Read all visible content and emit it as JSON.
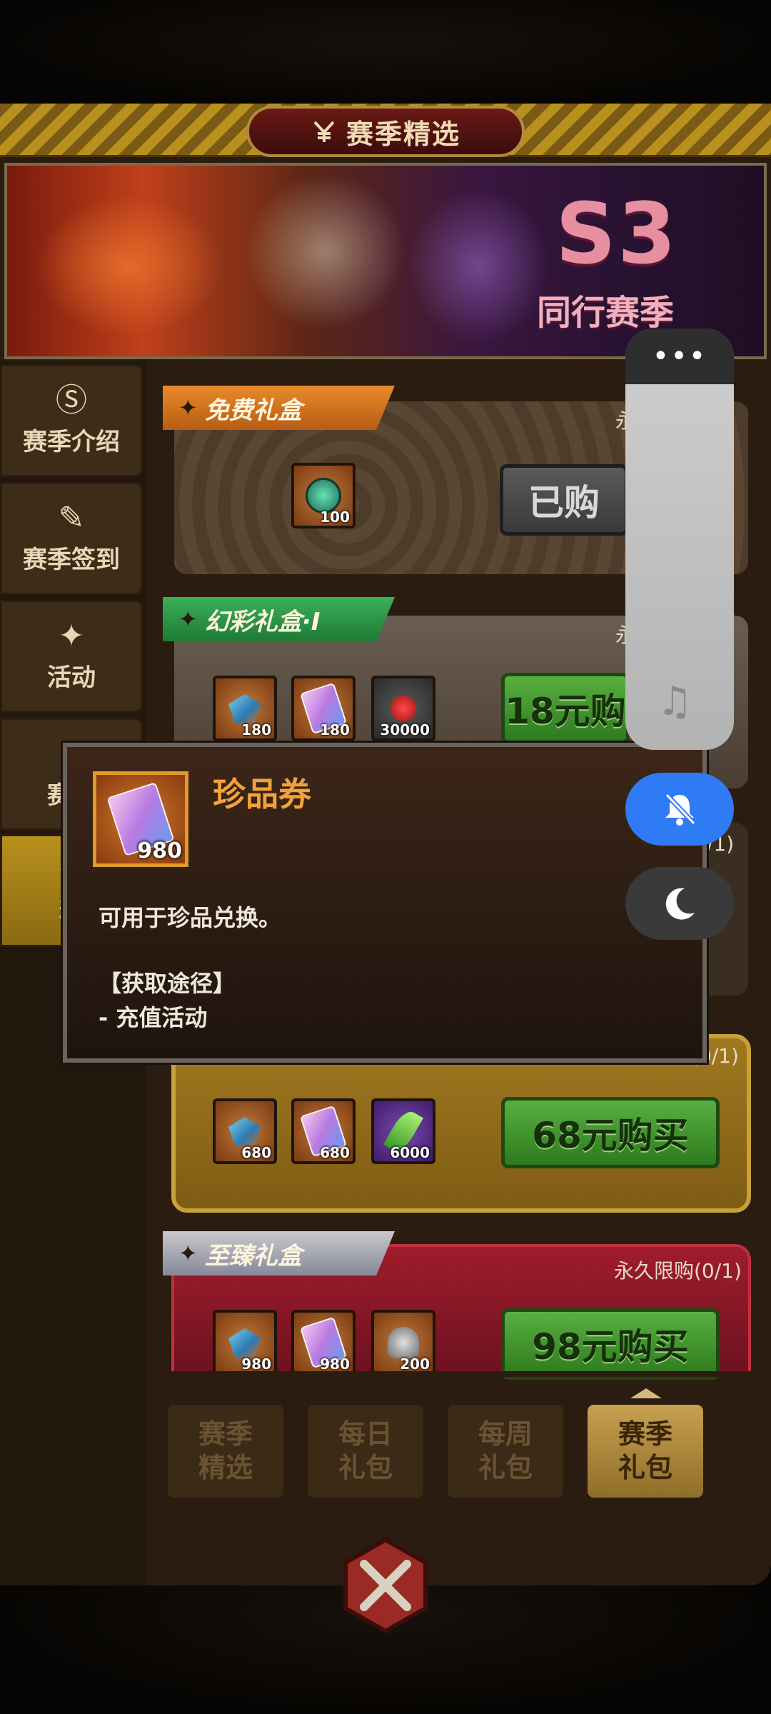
{
  "header": {
    "title": "赛季精选",
    "title_icon": "yen-scissor-icon"
  },
  "banner": {
    "season_code": "S3",
    "season_name": "同行赛季"
  },
  "sidebar": {
    "items": [
      {
        "label": "赛季介绍",
        "icon": "s-badge-icon",
        "active": false
      },
      {
        "label": "赛季签到",
        "icon": "pen-icon",
        "active": false
      },
      {
        "label": "活动",
        "icon": "gift-icon",
        "active": false
      },
      {
        "label": "赛季",
        "icon": "star-icon",
        "active": false
      },
      {
        "label": "精",
        "icon": "crest-icon",
        "active": true
      }
    ]
  },
  "gifts": [
    {
      "name": "免费礼盒",
      "limit": "永",
      "items": [
        {
          "icon": "coin-icon",
          "qty": "100"
        }
      ],
      "button": "已购"
    },
    {
      "name": "幻彩礼盒·I",
      "limit": "永",
      "items": [
        {
          "icon": "gem-icon",
          "qty": "180"
        },
        {
          "icon": "ticket-icon",
          "qty": "180"
        },
        {
          "icon": "flower-icon",
          "qty": "30000"
        }
      ],
      "button": "18元购"
    },
    {
      "name": "",
      "limit": "/1)",
      "items": [],
      "button": ""
    },
    {
      "name": "",
      "limit": "(0/1)",
      "items": [
        {
          "icon": "gem-icon",
          "qty": "680"
        },
        {
          "icon": "ticket-icon",
          "qty": "680"
        },
        {
          "icon": "leaf-icon",
          "qty": "6000"
        }
      ],
      "button": "68元购买"
    },
    {
      "name": "至臻礼盒",
      "limit": "永久限购(0/1)",
      "items": [
        {
          "icon": "gem-icon",
          "qty": "980"
        },
        {
          "icon": "ticket-icon",
          "qty": "980"
        },
        {
          "icon": "bell-icon",
          "qty": "200"
        }
      ],
      "button": "98元购买"
    }
  ],
  "bottom_tabs": [
    {
      "line1": "赛季",
      "line2": "精选",
      "active": false
    },
    {
      "line1": "每日",
      "line2": "礼包",
      "active": false
    },
    {
      "line1": "每周",
      "line2": "礼包",
      "active": false
    },
    {
      "line1": "赛季",
      "line2": "礼包",
      "active": true
    }
  ],
  "tooltip": {
    "title": "珍品券",
    "qty": "980",
    "description": "可用于珍品兑换。",
    "source_header": "【获取途径】",
    "source_item": "- 充值活动"
  },
  "system_panel": {
    "menu": "•••",
    "icons": [
      "music-note-icon",
      "bell-off-icon",
      "moon-icon"
    ]
  },
  "colors": {
    "accent_gold": "#b8901d",
    "button_green": "#3a8a28",
    "tooltip_title": "#f3a23a",
    "bell_blue": "#2f7bf5"
  }
}
